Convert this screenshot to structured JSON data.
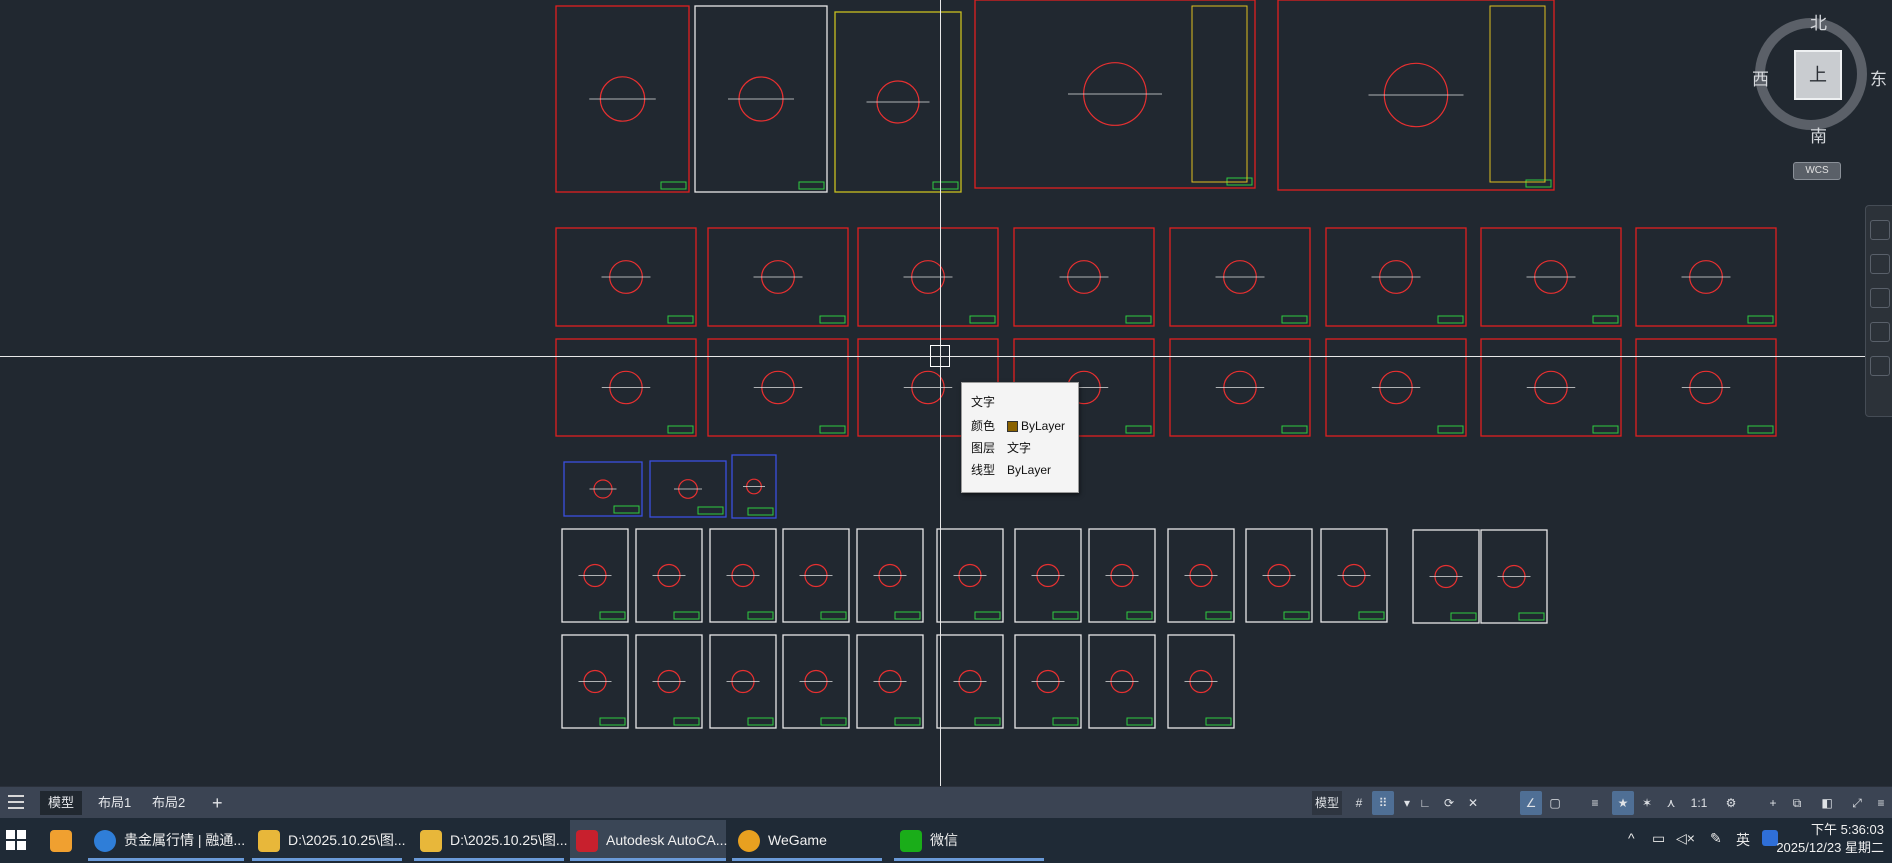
{
  "viewcube": {
    "north": "北",
    "south": "南",
    "east": "东",
    "west": "西",
    "face": "上",
    "wcs": "WCS"
  },
  "tooltip": {
    "title": "文字",
    "rows": [
      {
        "key": "颜色",
        "value": "ByLayer",
        "swatch": "#8a6200"
      },
      {
        "key": "图层",
        "value": "文字"
      },
      {
        "key": "线型",
        "value": "ByLayer"
      }
    ]
  },
  "layout_tabs": {
    "model": "模型",
    "layout1": "布局1",
    "layout2": "布局2",
    "add": "+"
  },
  "statusbar": {
    "model": "模型",
    "scale": "1:1",
    "icons": [
      "grid-icon",
      "snap-grid-icon",
      "ortho-icon",
      "polar-icon",
      "osnap-icon",
      "otrack-icon",
      "lineweight-icon",
      "annotation-icon",
      "gear-icon",
      "plus-icon",
      "workspace-icon",
      "fullscreen-icon",
      "customize-icon"
    ]
  },
  "taskbar": {
    "items": [
      {
        "label": "贵金属行情 | 融通...",
        "icon": "edge-browser-icon",
        "color": "#2f7ed8"
      },
      {
        "label": "D:\\2025.10.25\\图...",
        "icon": "folder-icon",
        "color": "#e8b73a"
      },
      {
        "label": "D:\\2025.10.25\\图...",
        "icon": "folder-icon",
        "color": "#e8b73a"
      },
      {
        "label": "Autodesk AutoCA...",
        "icon": "autocad-icon",
        "color": "#c8202d"
      },
      {
        "label": "WeGame",
        "icon": "wegame-icon",
        "color": "#e8a020"
      },
      {
        "label": "微信",
        "icon": "wechat-icon",
        "color": "#1aad19"
      }
    ],
    "ime": "英",
    "time": "下午 5:36:03",
    "date": "2025/12/23 星期二"
  },
  "colors": {
    "background": "#212830",
    "frame_red": "#e02020",
    "frame_white": "#e8e8e8",
    "frame_blue": "#3a4fe0",
    "frame_yellow": "#c8c020"
  }
}
